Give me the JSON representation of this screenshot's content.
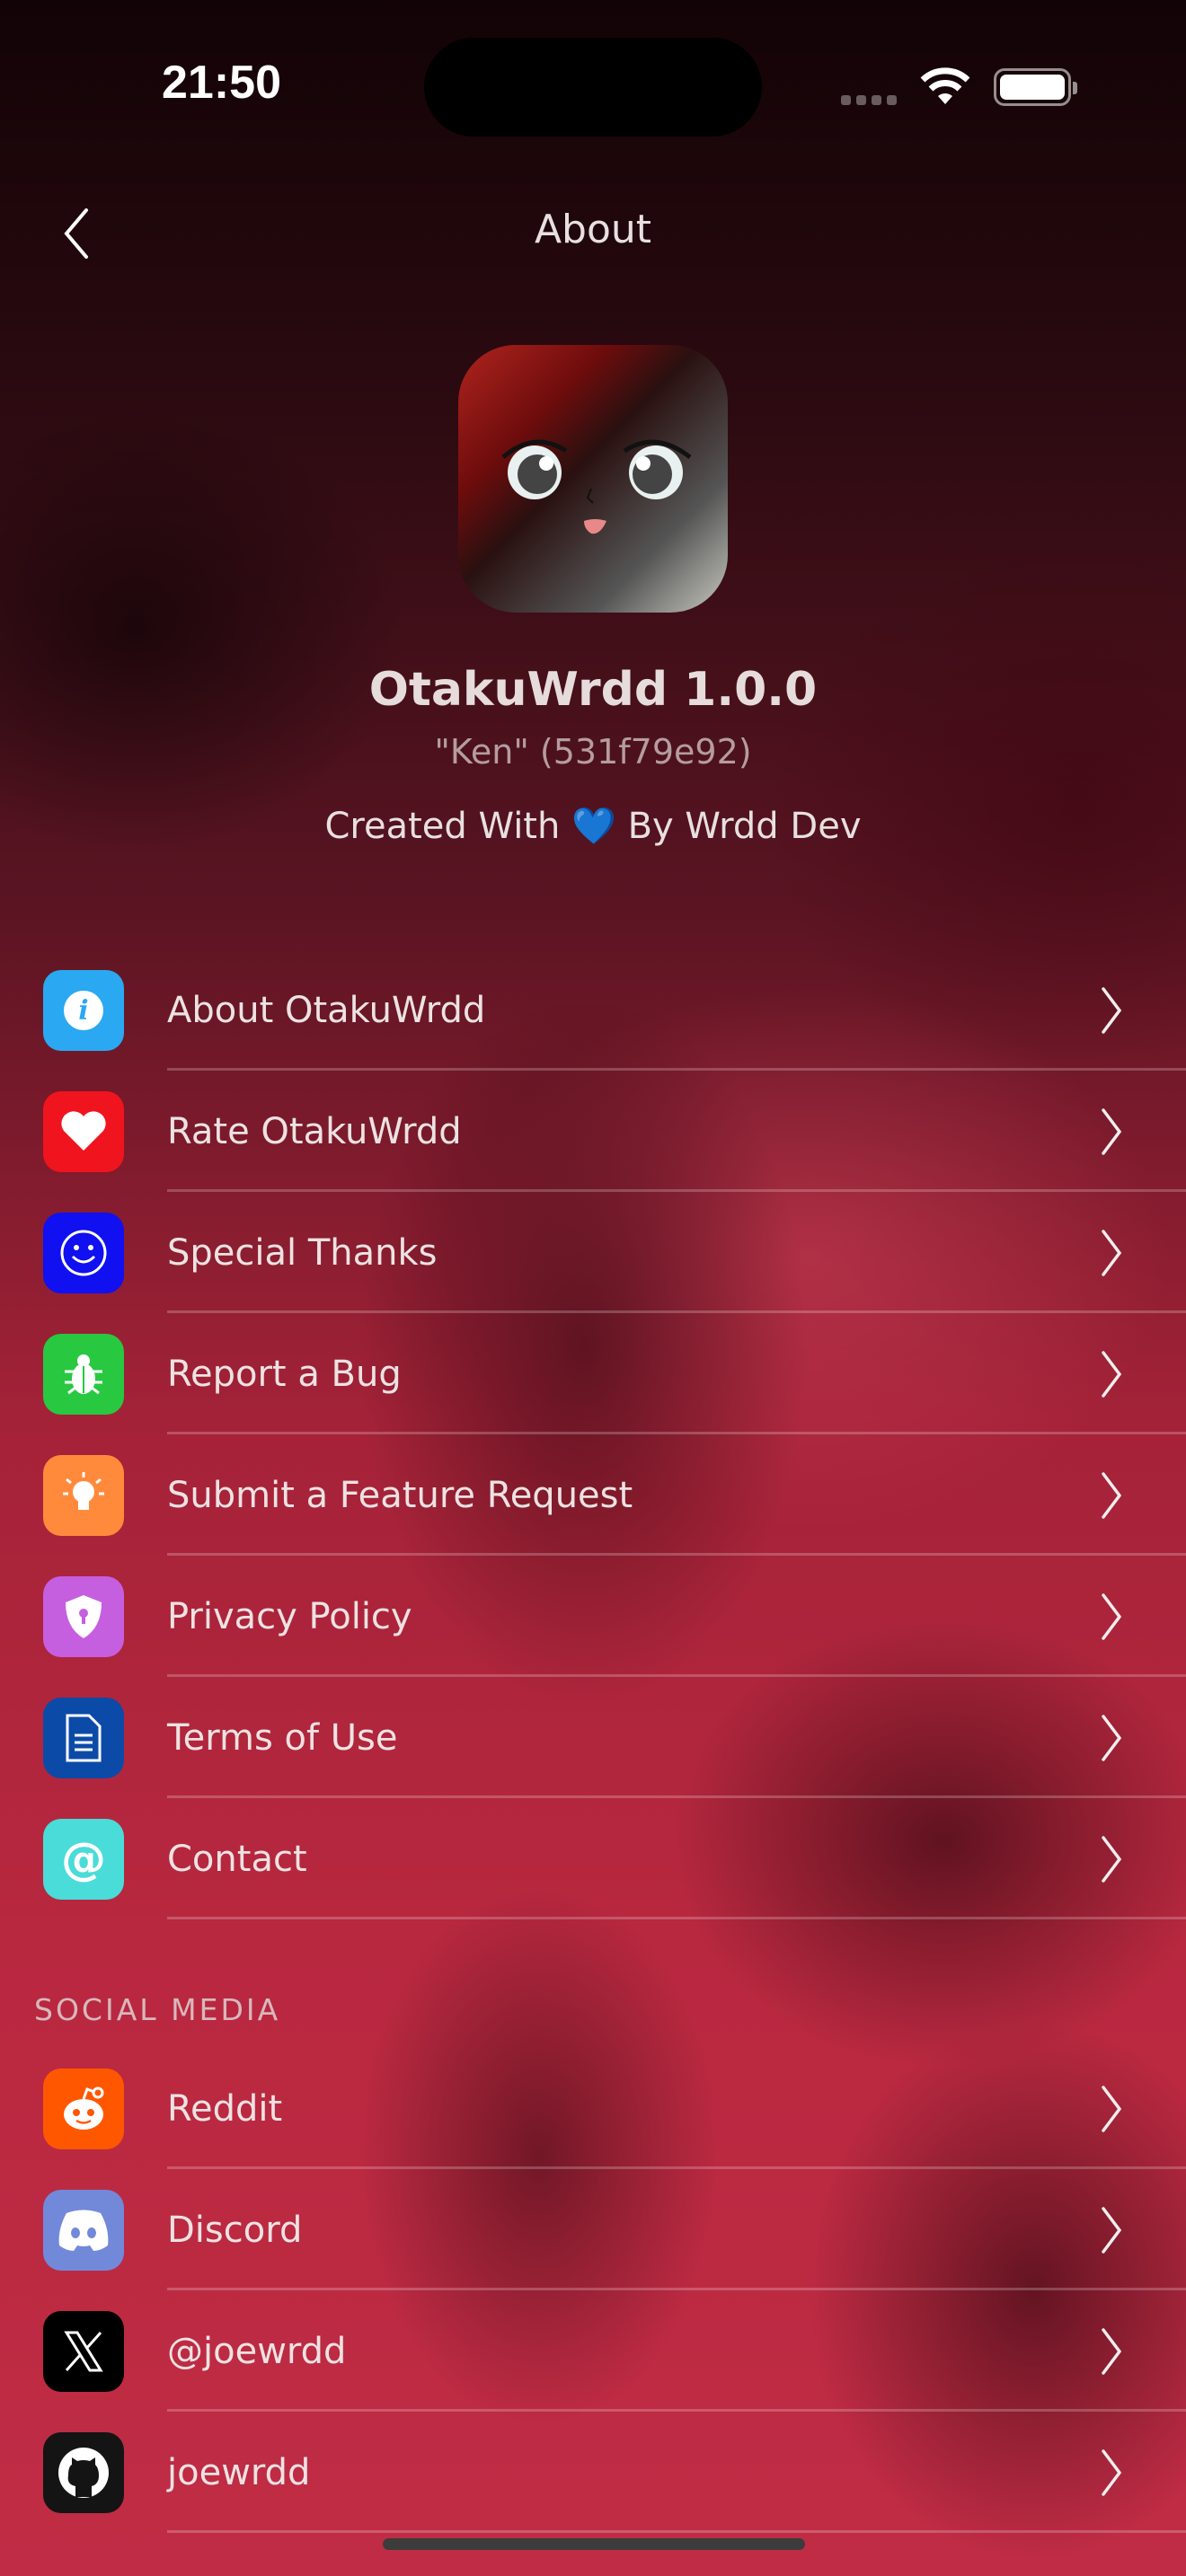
{
  "status_bar": {
    "time": "21:50"
  },
  "nav": {
    "title": "About"
  },
  "app": {
    "name": "OtakuWrdd 1.0.0",
    "build": "\"Ken\" (531f79e92)",
    "credit_before": "Created With",
    "credit_heart": "💙",
    "credit_after": "By Wrdd Dev"
  },
  "items": [
    {
      "label": "About OtakuWrdd",
      "icon": "info-icon",
      "color": "#2aa8f2"
    },
    {
      "label": "Rate OtakuWrdd",
      "icon": "heart-icon",
      "color": "#f0141e"
    },
    {
      "label": "Special Thanks",
      "icon": "smiley-icon",
      "color": "#1010f0"
    },
    {
      "label": "Report a Bug",
      "icon": "bug-icon",
      "color": "#28c840"
    },
    {
      "label": "Submit a Feature Request",
      "icon": "lightbulb-icon",
      "color": "#ff8a3c"
    },
    {
      "label": "Privacy Policy",
      "icon": "shield-icon",
      "color": "#c65ee0"
    },
    {
      "label": "Terms of Use",
      "icon": "document-icon",
      "color": "#0c4aa8"
    },
    {
      "label": "Contact",
      "icon": "at-icon",
      "color": "#4adcd8"
    }
  ],
  "social": {
    "header": "SOCIAL MEDIA",
    "items": [
      {
        "label": "Reddit",
        "icon": "reddit-icon",
        "color": "#ff5700"
      },
      {
        "label": "Discord",
        "icon": "discord-icon",
        "color": "#7289da"
      },
      {
        "label": "@joewrdd",
        "icon": "x-icon",
        "color": "#000000"
      },
      {
        "label": "joewrdd",
        "icon": "github-icon",
        "color": "#141414"
      }
    ]
  }
}
